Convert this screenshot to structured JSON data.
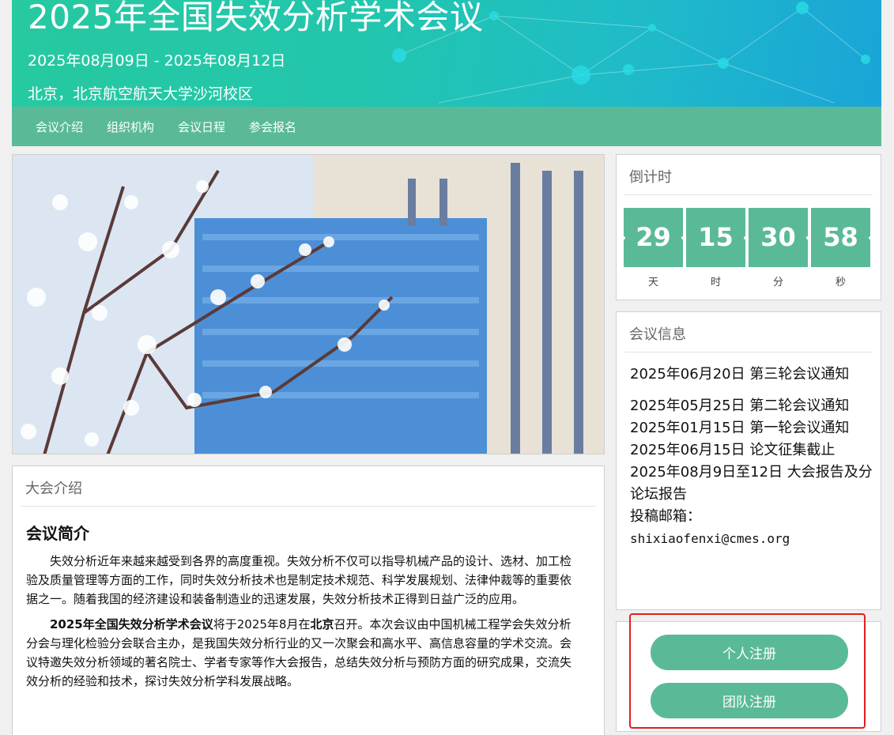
{
  "header": {
    "title": "2025年全国失效分析学术会议",
    "dates": "2025年08月09日 - 2025年08月12日",
    "location": "北京，北京航空航天大学沙河校区"
  },
  "nav": {
    "items": [
      "会议介绍",
      "组织机构",
      "会议日程",
      "参会报名"
    ]
  },
  "intro": {
    "card_title": "大会介绍",
    "heading": "会议简介",
    "p1": "失效分析近年来越来越受到各界的高度重视。失效分析不仅可以指导机械产品的设计、选材、加工检验及质量管理等方面的工作，同时失效分析技术也是制定技术规范、科学发展规划、法律仲裁等的重要依据之一。随着我国的经济建设和装备制造业的迅速发展，失效分析技术正得到日益广泛的应用。",
    "p2_bold_name": "2025年全国失效分析学术会议",
    "p2_mid": "将于2025年8月在",
    "p2_bold_city": "北京",
    "p2_rest": "召开。本次会议由中国机械工程学会失效分析分会与理化检验分会联合主办，是我国失效分析行业的又一次聚会和高水平、高信息容量的学术交流。会议特邀失效分析领域的著名院士、学者专家等作大会报告，总结失效分析与预防方面的研究成果，交流失效分析的经验和技术，探讨失效分析学科发展战略。"
  },
  "countdown": {
    "title": "倒计时",
    "cells": [
      {
        "value": "29",
        "unit": "天"
      },
      {
        "value": "15",
        "unit": "时"
      },
      {
        "value": "30",
        "unit": "分"
      },
      {
        "value": "58",
        "unit": "秒"
      }
    ]
  },
  "info": {
    "title": "会议信息",
    "items": [
      "2025年06月20日 第三轮会议通知",
      "2025年05月25日 第二轮会议通知",
      "2025年01月15日 第一轮会议通知",
      "2025年06月15日 论文征集截止",
      "2025年08月9日至12日 大会报告及分论坛报告",
      "投稿邮箱：",
      "shixiaofenxi@cmes.org"
    ]
  },
  "register": {
    "personal": "个人注册",
    "team": "团队注册"
  },
  "colors": {
    "accent": "#5aba97",
    "highlight": "#e02020"
  }
}
